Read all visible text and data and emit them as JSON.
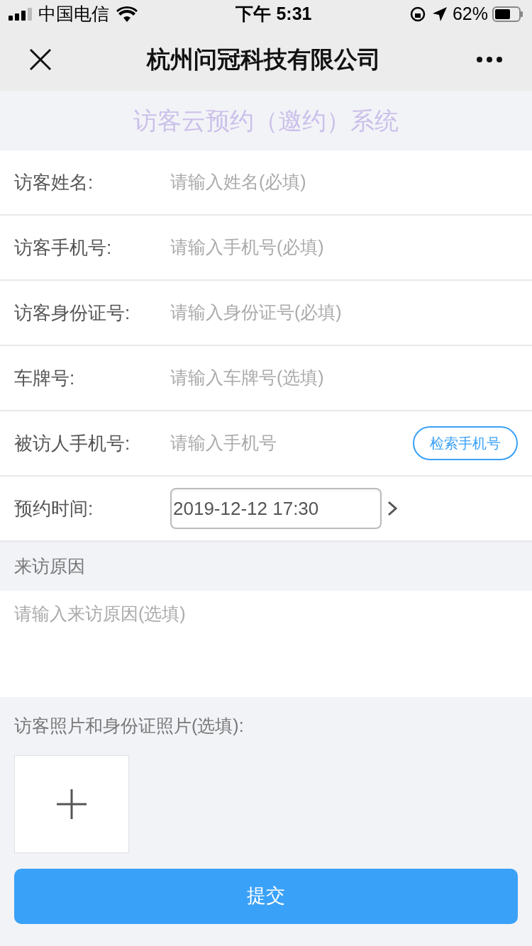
{
  "status_bar": {
    "carrier": "中国电信",
    "time": "下午 5:31",
    "battery": "62%"
  },
  "nav": {
    "title": "杭州问冠科技有限公司"
  },
  "subtitle": "访客云预约（邀约）系统",
  "fields": [
    {
      "kind": "text",
      "label": "访客姓名:",
      "placeholder": "请输入姓名(必填)"
    },
    {
      "kind": "text",
      "label": "访客手机号:",
      "placeholder": "请输入手机号(必填)"
    },
    {
      "kind": "text",
      "label": "访客身份证号:",
      "placeholder": "请输入身份证号(必填)"
    },
    {
      "kind": "text",
      "label": "车牌号:",
      "placeholder": "请输入车牌号(选填)"
    },
    {
      "kind": "search",
      "label": "被访人手机号:",
      "placeholder": "请输入手机号",
      "button": "检索手机号"
    },
    {
      "kind": "date",
      "label": "预约时间:",
      "value": "2019-12-12 17:30"
    }
  ],
  "reason": {
    "label": "来访原因",
    "placeholder": "请输入来访原因(选填)"
  },
  "photos": {
    "label": "访客照片和身份证照片(选填):"
  },
  "submit": "提交"
}
